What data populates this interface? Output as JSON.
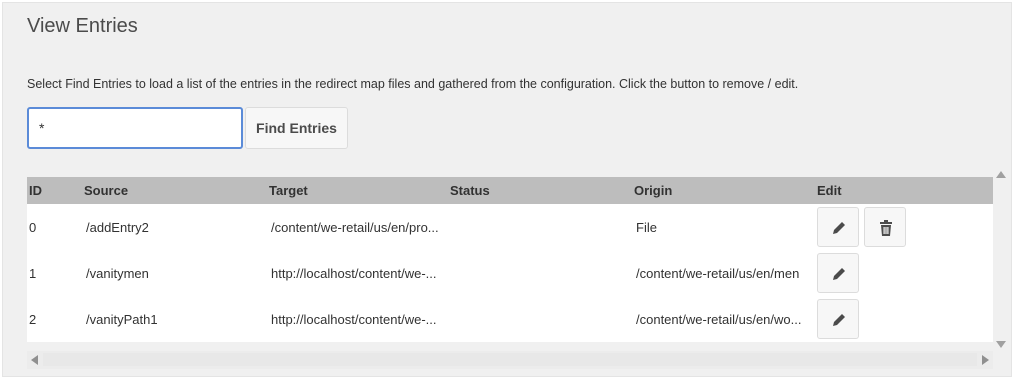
{
  "page": {
    "title": "View Entries",
    "description": "Select Find Entries to load a list of the entries in the redirect map files and gathered from the configuration. Click the button to remove / edit."
  },
  "search": {
    "value": "*",
    "button_label": "Find Entries"
  },
  "table": {
    "headers": {
      "id": "ID",
      "source": "Source",
      "target": "Target",
      "status": "Status",
      "origin": "Origin",
      "edit": "Edit"
    },
    "rows": [
      {
        "id": "0",
        "source": "/addEntry2",
        "target": "/content/we-retail/us/en/pro...",
        "status": "",
        "origin": "File",
        "has_delete": true
      },
      {
        "id": "1",
        "source": "/vanitymen",
        "target": "http://localhost/content/we-...",
        "status": "",
        "origin": "/content/we-retail/us/en/men",
        "has_delete": false
      },
      {
        "id": "2",
        "source": "/vanityPath1",
        "target": "http://localhost/content/we-...",
        "status": "",
        "origin": "/content/we-retail/us/en/wo...",
        "has_delete": false
      }
    ]
  },
  "icons": {
    "edit": "pencil-icon",
    "delete": "trash-icon"
  },
  "colors": {
    "input_focus_border": "#5b8bd8",
    "header_bg": "#bdbdbd",
    "panel_bg": "#f0f0f0"
  }
}
